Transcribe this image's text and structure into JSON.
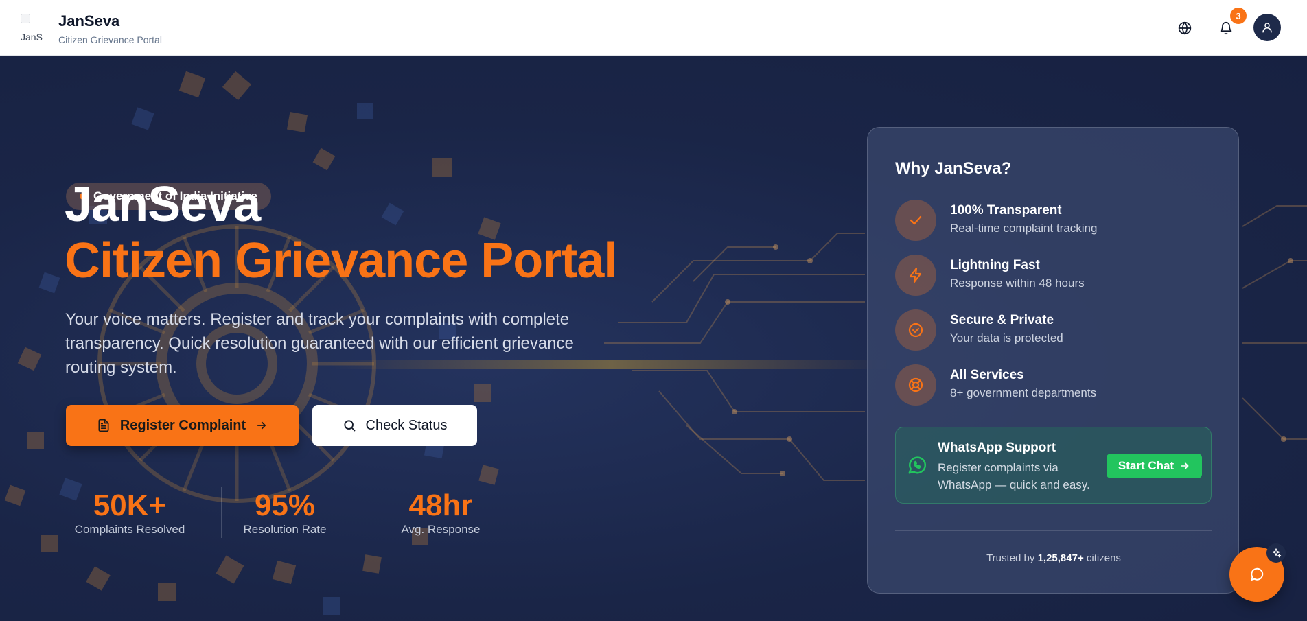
{
  "header": {
    "logo_alt": "JanS",
    "title": "JanSeva",
    "subtitle": "Citizen Grievance Portal",
    "notification_count": "3"
  },
  "hero": {
    "badge": "Government of India Initiative",
    "title_line1": "JanSeva",
    "title_line2": "Citizen Grievance Portal",
    "description": "Your voice matters. Register and track your complaints with complete transparency. Quick resolution guaranteed with our efficient grievance routing system.",
    "primary_button": "Register Complaint",
    "secondary_button": "Check Status",
    "stats": [
      {
        "value": "50K+",
        "label": "Complaints Resolved"
      },
      {
        "value": "95%",
        "label": "Resolution Rate"
      },
      {
        "value": "48hr",
        "label": "Avg. Response"
      }
    ]
  },
  "card": {
    "title": "Why JanSeva?",
    "features": [
      {
        "title": "100% Transparent",
        "desc": "Real-time complaint tracking",
        "icon": "check-icon"
      },
      {
        "title": "Lightning Fast",
        "desc": "Response within 48 hours",
        "icon": "lightning-icon"
      },
      {
        "title": "Secure & Private",
        "desc": "Your data is protected",
        "icon": "shield-check-icon"
      },
      {
        "title": "All Services",
        "desc": "8+ government departments",
        "icon": "lifebuoy-icon"
      }
    ],
    "whatsapp": {
      "title": "WhatsApp Support",
      "desc": "Register complaints via WhatsApp — quick and easy.",
      "button": "Start Chat"
    },
    "trust_prefix": "Trusted by",
    "trust_count": "1,25,847+",
    "trust_suffix": "citizens"
  },
  "colors": {
    "accent": "#f97316",
    "background": "#1a2547",
    "whatsapp": "#22c55e"
  }
}
